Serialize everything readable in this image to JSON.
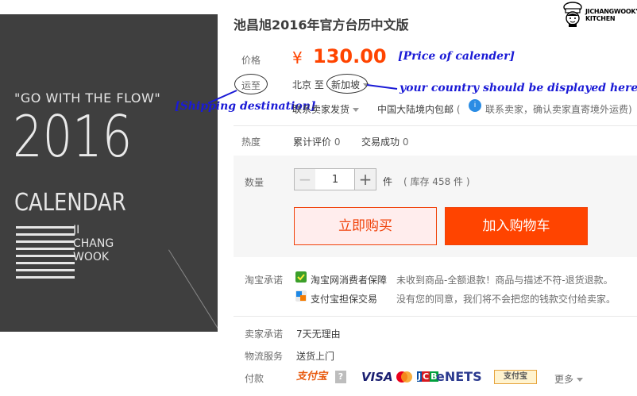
{
  "product": {
    "title": "池昌旭2016年官方台历中文版",
    "image": {
      "slogan": "\"GO WITH THE FLOW\"",
      "year": "2016",
      "word": "CALENDAR",
      "name_lines": [
        "JI",
        "CHANG",
        "WOOK"
      ]
    }
  },
  "logo": {
    "text_line1": "JICHANGWOOK'S",
    "text_line2": "KITCHEN"
  },
  "price": {
    "label": "价格",
    "symbol": "¥",
    "value": "130.00"
  },
  "shipping": {
    "label": "运至",
    "from": "北京",
    "to_word": "至",
    "destination": "新加坡",
    "contact_seller": "联系卖家发货",
    "mainland_free": "中国大陆境内包邮",
    "paren_open": "(",
    "info_text": "联系卖家，确认卖家直寄境外运费)"
  },
  "annotations": {
    "price_note": "[Price of calender]",
    "shipping_note": "[Shipping destination]",
    "country_note": "your country should be displayed here"
  },
  "stats": {
    "label": "热度",
    "reviews_label": "累计评价",
    "reviews_count": "0",
    "sales_label": "交易成功",
    "sales_count": "0"
  },
  "quantity": {
    "label": "数量",
    "minus": "−",
    "plus": "+",
    "value": "1",
    "unit": "件",
    "stock": "( 库存 458 件 )"
  },
  "actions": {
    "buy_now": "立即购买",
    "add_to_cart": "加入购物车"
  },
  "promise": {
    "label": "淘宝承诺",
    "items": [
      {
        "title": "淘宝网消费者保障",
        "desc": "未收到商品-全额退款！商品与描述不符-退货退款。"
      },
      {
        "title": "支付宝担保交易",
        "desc": "没有您的同意，我们将不会把您的钱款交付给卖家。"
      }
    ]
  },
  "seller_promise": {
    "label": "卖家承诺",
    "value": "7天无理由"
  },
  "logistics": {
    "label": "物流服务",
    "value": "送货上门"
  },
  "payment": {
    "label": "付款",
    "alipay": "支付宝",
    "help": "?",
    "visa": "VISA",
    "jcb": "JCB",
    "nets": "eNETS",
    "more": "更多"
  },
  "colors": {
    "accent": "#ff4400",
    "annotation": "#1a1ad6",
    "image_bg": "#3f3f3f"
  }
}
